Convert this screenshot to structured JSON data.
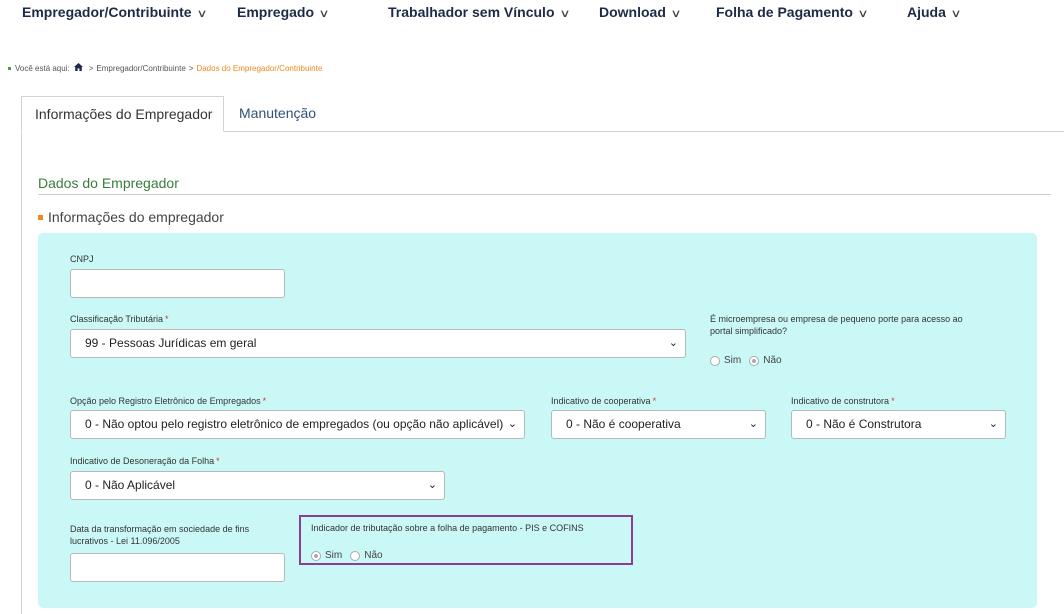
{
  "nav": {
    "items": [
      {
        "label": "Empregador/Contribuinte"
      },
      {
        "label": "Empregado"
      },
      {
        "label": "Trabalhador sem Vínculo"
      },
      {
        "label": "Download"
      },
      {
        "label": "Folha de Pagamento"
      },
      {
        "label": "Ajuda"
      }
    ]
  },
  "breadcrumb": {
    "prefix": "Você está aqui:",
    "parent": "Empregador/Contribuinte",
    "current": "Dados do Empregador/Contribuinte",
    "separator": ">"
  },
  "tabs": [
    {
      "label": "Informações do Empregador",
      "active": true
    },
    {
      "label": "Manutenção",
      "active": false
    }
  ],
  "section": {
    "title": "Dados do Empregador",
    "subtitle": "Informações do empregador"
  },
  "form": {
    "cnpj": {
      "label": "CNPJ",
      "value": ""
    },
    "classificacao": {
      "label": "Classificação Tributária",
      "value": "99 - Pessoas Jurídicas em geral"
    },
    "microempresa": {
      "label_line1": "É microempresa ou empresa de pequeno porte para acesso ao",
      "label_line2": "portal simplificado?",
      "opt_yes": "Sim",
      "opt_no": "Não",
      "selected": "Não"
    },
    "registro_eletronico": {
      "label": "Opção pelo Registro Eletrônico de Empregados",
      "value": "0 - Não optou pelo registro eletrônico de empregados (ou opção não aplicável)"
    },
    "cooperativa": {
      "label": "Indicativo de cooperativa",
      "value": "0 - Não é cooperativa"
    },
    "construtora": {
      "label": "Indicativo de construtora",
      "value": "0 - Não é Construtora"
    },
    "desoneracao": {
      "label": "Indicativo de Desoneração da Folha",
      "value": "0 - Não Aplicável"
    },
    "data_transformacao": {
      "label_line1": "Data da transformação em sociedade de fins",
      "label_line2": "lucrativos - Lei 11.096/2005",
      "value": ""
    },
    "pis_cofins": {
      "label": "Indicador de tributação sobre a folha de pagamento - PIS e COFINS",
      "opt_yes": "Sim",
      "opt_no": "Não",
      "selected": "Sim"
    },
    "required_mark": "*"
  },
  "colors": {
    "accent_orange": "#f08a1c",
    "section_green": "#3a7d3a",
    "form_bg": "#c9f8f6",
    "highlight_border": "#8a3f93"
  }
}
